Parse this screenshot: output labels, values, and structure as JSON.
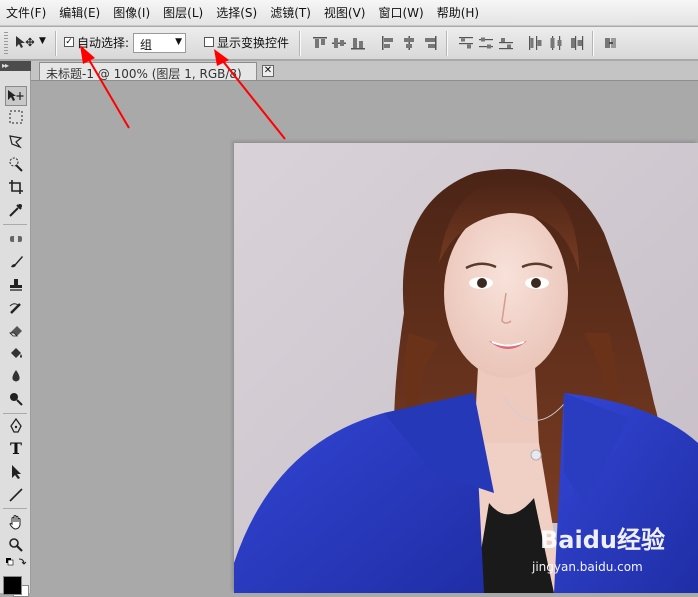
{
  "menu": {
    "items": [
      "文件(F)",
      "编辑(E)",
      "图像(I)",
      "图层(L)",
      "选择(S)",
      "滤镜(T)",
      "视图(V)",
      "窗口(W)",
      "帮助(H)"
    ]
  },
  "options_bar": {
    "auto_select_label": "自动选择:",
    "auto_select_checked": true,
    "auto_select_target": "组",
    "show_transform_label": "显示变换控件",
    "show_transform_checked": false
  },
  "document": {
    "tab_title": "未标题-1 @ 100% (图层 1, RGB/8)",
    "close_glyph": "✕"
  },
  "toolbox": {
    "collapse_glyph": "▸▸",
    "type_tool_glyph": "T"
  },
  "watermark": {
    "brand": "Baidu经验",
    "url": "jingyan.baidu.com"
  },
  "colors": {
    "foreground": "#000000",
    "background": "#ffffff",
    "annotation_arrow": "#ff0000",
    "jacket": "#2a3fc6"
  }
}
